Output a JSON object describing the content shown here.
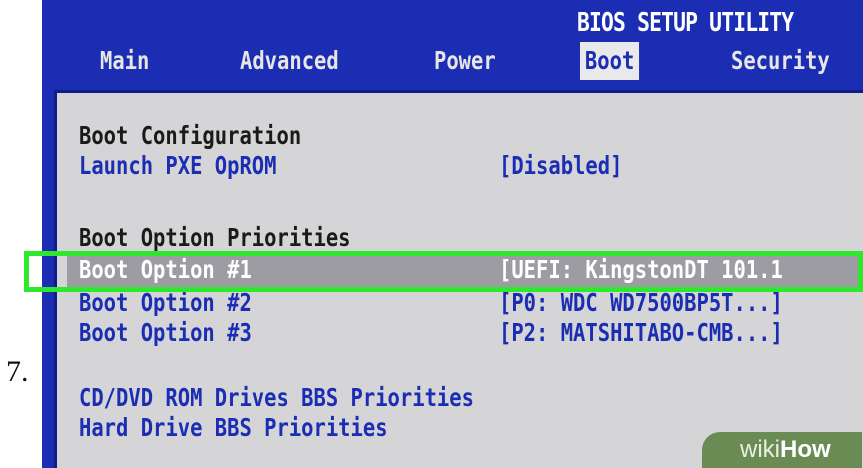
{
  "step_number": "7.",
  "bios": {
    "title": "BIOS SETUP UTILITY",
    "tabs": [
      {
        "label": "Main"
      },
      {
        "label": "Advanced"
      },
      {
        "label": "Power"
      },
      {
        "label": "Boot"
      },
      {
        "label": "Security"
      }
    ],
    "active_tab": "Boot",
    "sections": {
      "boot_configuration": "Boot Configuration",
      "launch_pxe_label": "Launch PXE OpROM",
      "launch_pxe_value": "[Disabled]",
      "boot_option_priorities": "Boot Option Priorities",
      "boot_options": [
        {
          "label": "Boot Option #1",
          "value": "[UEFI: KingstonDT 101.1"
        },
        {
          "label": "Boot Option #2",
          "value": "[P0: WDC WD7500BP5T...]"
        },
        {
          "label": "Boot Option #3",
          "value": "[P2: MATSHITABO-CMB...]"
        }
      ],
      "cd_dvd": "CD/DVD ROM Drives BBS Priorities",
      "hard_drive": "Hard Drive BBS Priorities"
    }
  },
  "watermark": {
    "part1": "wiki",
    "part2": "How"
  },
  "colors": {
    "bios_blue": "#1b2db3",
    "panel_gray": "#d5d5d7",
    "selection_gray": "#9c9ca2",
    "highlight_green": "#2ee82e"
  }
}
